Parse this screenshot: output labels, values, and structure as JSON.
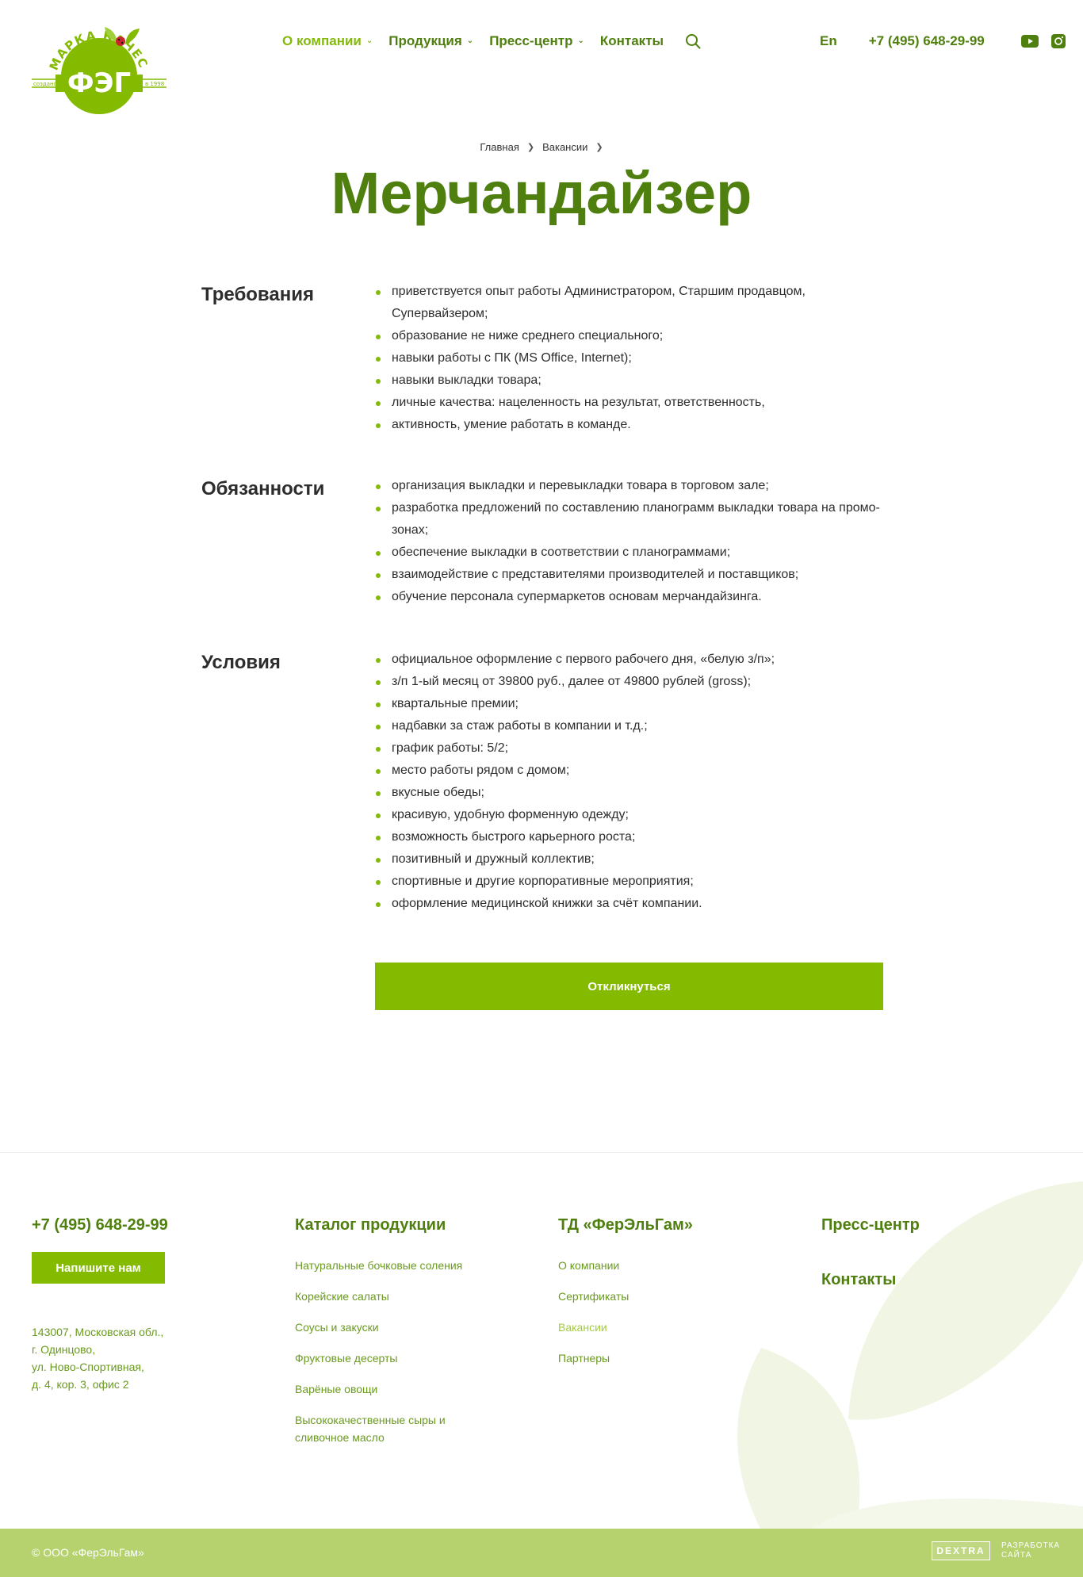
{
  "colors": {
    "brand_green": "#84bb00",
    "dark_green": "#4f7f0e",
    "footer_bar": "#b5d26f"
  },
  "logo": {
    "arc_text": "МАРКА КАЧЕСТВА",
    "brand": "ФЭГ",
    "left_text": "создано",
    "right_text": "в 1998"
  },
  "nav": {
    "items": [
      {
        "label": "О компании",
        "has_dropdown": true,
        "active": true
      },
      {
        "label": "Продукция",
        "has_dropdown": true,
        "active": false
      },
      {
        "label": "Пресс-центр",
        "has_dropdown": true,
        "active": false
      },
      {
        "label": "Контакты",
        "has_dropdown": false,
        "active": false
      }
    ],
    "search_icon": "search-icon",
    "lang": "En",
    "phone": "+7 (495) 648-29-99",
    "social": [
      "youtube-icon",
      "instagram-icon"
    ]
  },
  "breadcrumb": [
    "Главная",
    "Вакансии"
  ],
  "title": "Мерчандайзер",
  "sections": [
    {
      "title": "Требования",
      "items": [
        "приветствуется опыт работы Администратором, Старшим продавцом, Супервайзером;",
        "образование не ниже среднего специального;",
        "навыки работы с ПК (MS Office, Internet);",
        "навыки выкладки товара;",
        "личные качества: нацеленность на результат, ответственность,",
        "активность, умение работать в команде."
      ]
    },
    {
      "title": "Обязанности",
      "items": [
        "организация выкладки и перевыкладки товара в торговом зале;",
        "разработка предложений по составлению планограмм выкладки товара на промо-зонах;",
        "обеспечение выкладки в соответствии с планограммами;",
        "взаимодействие с представителями производителей и поставщиков;",
        "обучение персонала супермаркетов основам мерчандайзинга."
      ]
    },
    {
      "title": "Условия",
      "items": [
        "официальное оформление с первого рабочего дня, «белую з/п»;",
        "з/п 1-ый месяц от 39800 руб., далее от 49800 рублей (gross);",
        "квартальные премии;",
        "надбавки за стаж работы в компании и т.д.;",
        "график работы: 5/2;",
        "место работы рядом с домом;",
        "вкусные обеды;",
        "красивую, удобную форменную одежду;",
        "возможность быстрого карьерного роста;",
        "позитивный и дружный коллектив;",
        "спортивные и другие корпоративные мероприятия;",
        "оформление медицинской книжки за счёт компании."
      ]
    }
  ],
  "apply_button": "Откликнуться",
  "footer": {
    "phone": "+7 (495) 648-29-99",
    "write_button": "Напишите нам",
    "address": [
      "143007, Московская обл.,",
      "г. Одинцово,",
      "ул. Ново-Спортивная,",
      "д. 4, кор. 3, офис 2"
    ],
    "catalog": {
      "title": "Каталог продукции",
      "links": [
        "Натуральные бочковые соления",
        "Корейские салаты",
        "Соусы и закуски",
        "Фруктовые десерты",
        "Варёные овощи",
        "Высококачественные сыры и сливочное масло"
      ]
    },
    "company": {
      "title": "ТД «ФерЭльГам»",
      "links": [
        {
          "label": "О компании",
          "active": false
        },
        {
          "label": "Сертификаты",
          "active": false
        },
        {
          "label": "Вакансии",
          "active": true
        },
        {
          "label": "Партнеры",
          "active": false
        }
      ]
    },
    "press": "Пресс-центр",
    "contacts": "Контакты",
    "copyright": "© ООО «ФерЭльГам»",
    "developer_logo": "DEXTRA",
    "developer_text": "РАЗРАБОТКА САЙТА"
  }
}
